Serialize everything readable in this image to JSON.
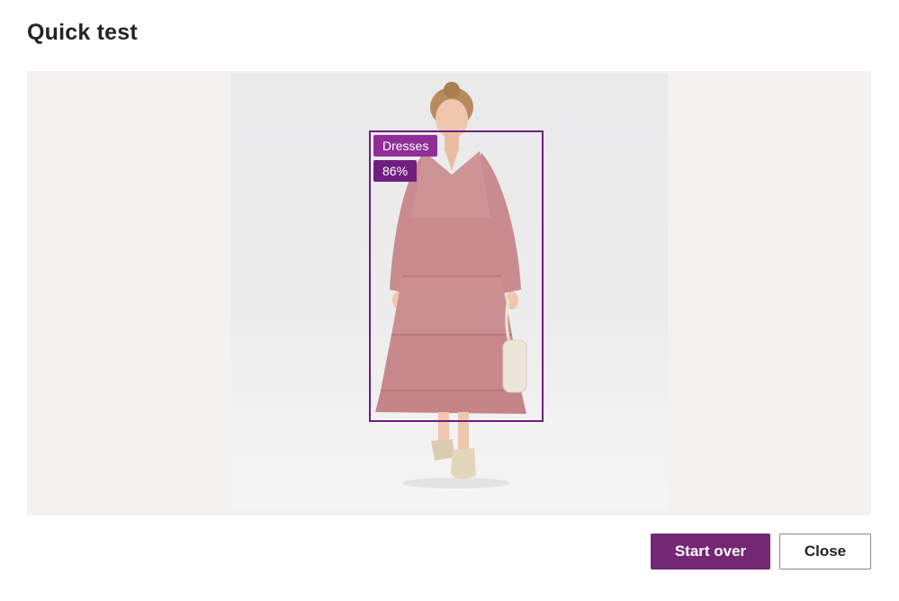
{
  "dialog": {
    "title": "Quick test"
  },
  "detection": {
    "label": "Dresses",
    "confidence": "86%",
    "box_color": "#6e1f7f"
  },
  "photo": {
    "subject": "product-photo-person-in-pink-tiered-dress"
  },
  "actions": {
    "start_over_label": "Start over",
    "close_label": "Close",
    "primary_color": "#742774"
  }
}
